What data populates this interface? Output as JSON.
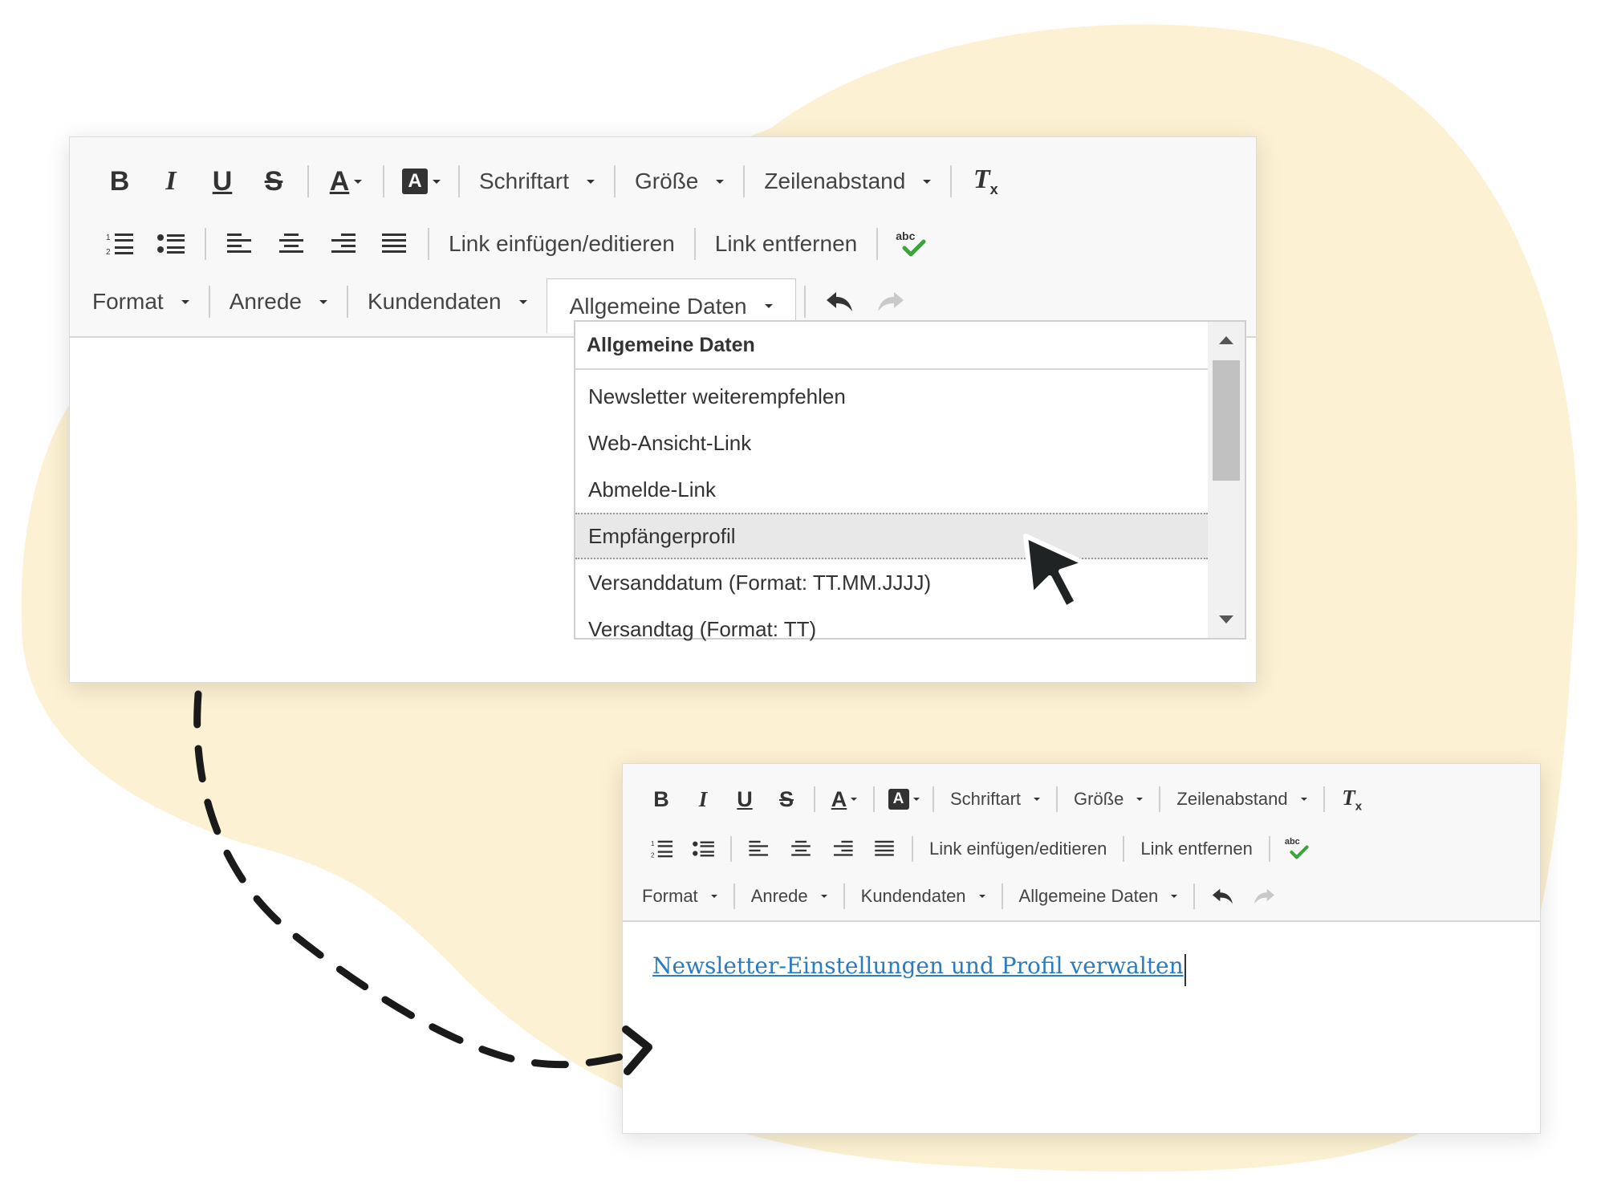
{
  "colors": {
    "blob": "#fdf1d3",
    "link": "#2a7bc0",
    "toolbar_bg": "#f8f8f8",
    "highlight": "#e8e8e8",
    "spellcheck_check": "#3aa53a"
  },
  "editor_main": {
    "toolbar": {
      "row1": {
        "bold": "B",
        "italic": "I",
        "underline": "U",
        "strike": "S",
        "text_color": "A",
        "bg_color": "A",
        "font": "Schriftart",
        "size": "Größe",
        "line_height": "Zeilenabstand",
        "clear": "T",
        "clear_sub": "x"
      },
      "row2": {
        "insert_link": "Link einfügen/editieren",
        "remove_link": "Link entfernen",
        "spell_abc": "abc"
      },
      "row3": {
        "format": "Format",
        "salutation": "Anrede",
        "customer_data": "Kundendaten",
        "general_data": "Allgemeine Daten"
      }
    },
    "dropdown": {
      "title": "Allgemeine Daten",
      "items": [
        "Newsletter weiterempfehlen",
        "Web-Ansicht-Link",
        "Abmelde-Link",
        "Empfängerprofil",
        "Versanddatum (Format: TT.MM.JJJJ)",
        "Versandtag (Format: TT)"
      ],
      "highlighted": "Empfängerprofil"
    }
  },
  "editor_result": {
    "toolbar": {
      "row1": {
        "bold": "B",
        "italic": "I",
        "underline": "U",
        "strike": "S",
        "text_color": "A",
        "bg_color": "A",
        "font": "Schriftart",
        "size": "Größe",
        "line_height": "Zeilenabstand",
        "clear": "T",
        "clear_sub": "x"
      },
      "row2": {
        "insert_link": "Link einfügen/editieren",
        "remove_link": "Link entfernen",
        "spell_abc": "abc"
      },
      "row3": {
        "format": "Format",
        "salutation": "Anrede",
        "customer_data": "Kundendaten",
        "general_data": "Allgemeine Daten"
      }
    },
    "content_link": "Newsletter-Einstellungen und Profil verwalten"
  },
  "icons": [
    "bold-icon",
    "italic-icon",
    "underline-icon",
    "strikethrough-icon",
    "text-color-icon",
    "background-color-icon",
    "clear-format-icon",
    "numbered-list-icon",
    "bullet-list-icon",
    "align-left-icon",
    "align-center-icon",
    "align-right-icon",
    "justify-icon",
    "spellcheck-icon",
    "undo-icon",
    "redo-icon",
    "mouse-pointer-icon",
    "dashed-arrow-icon"
  ]
}
